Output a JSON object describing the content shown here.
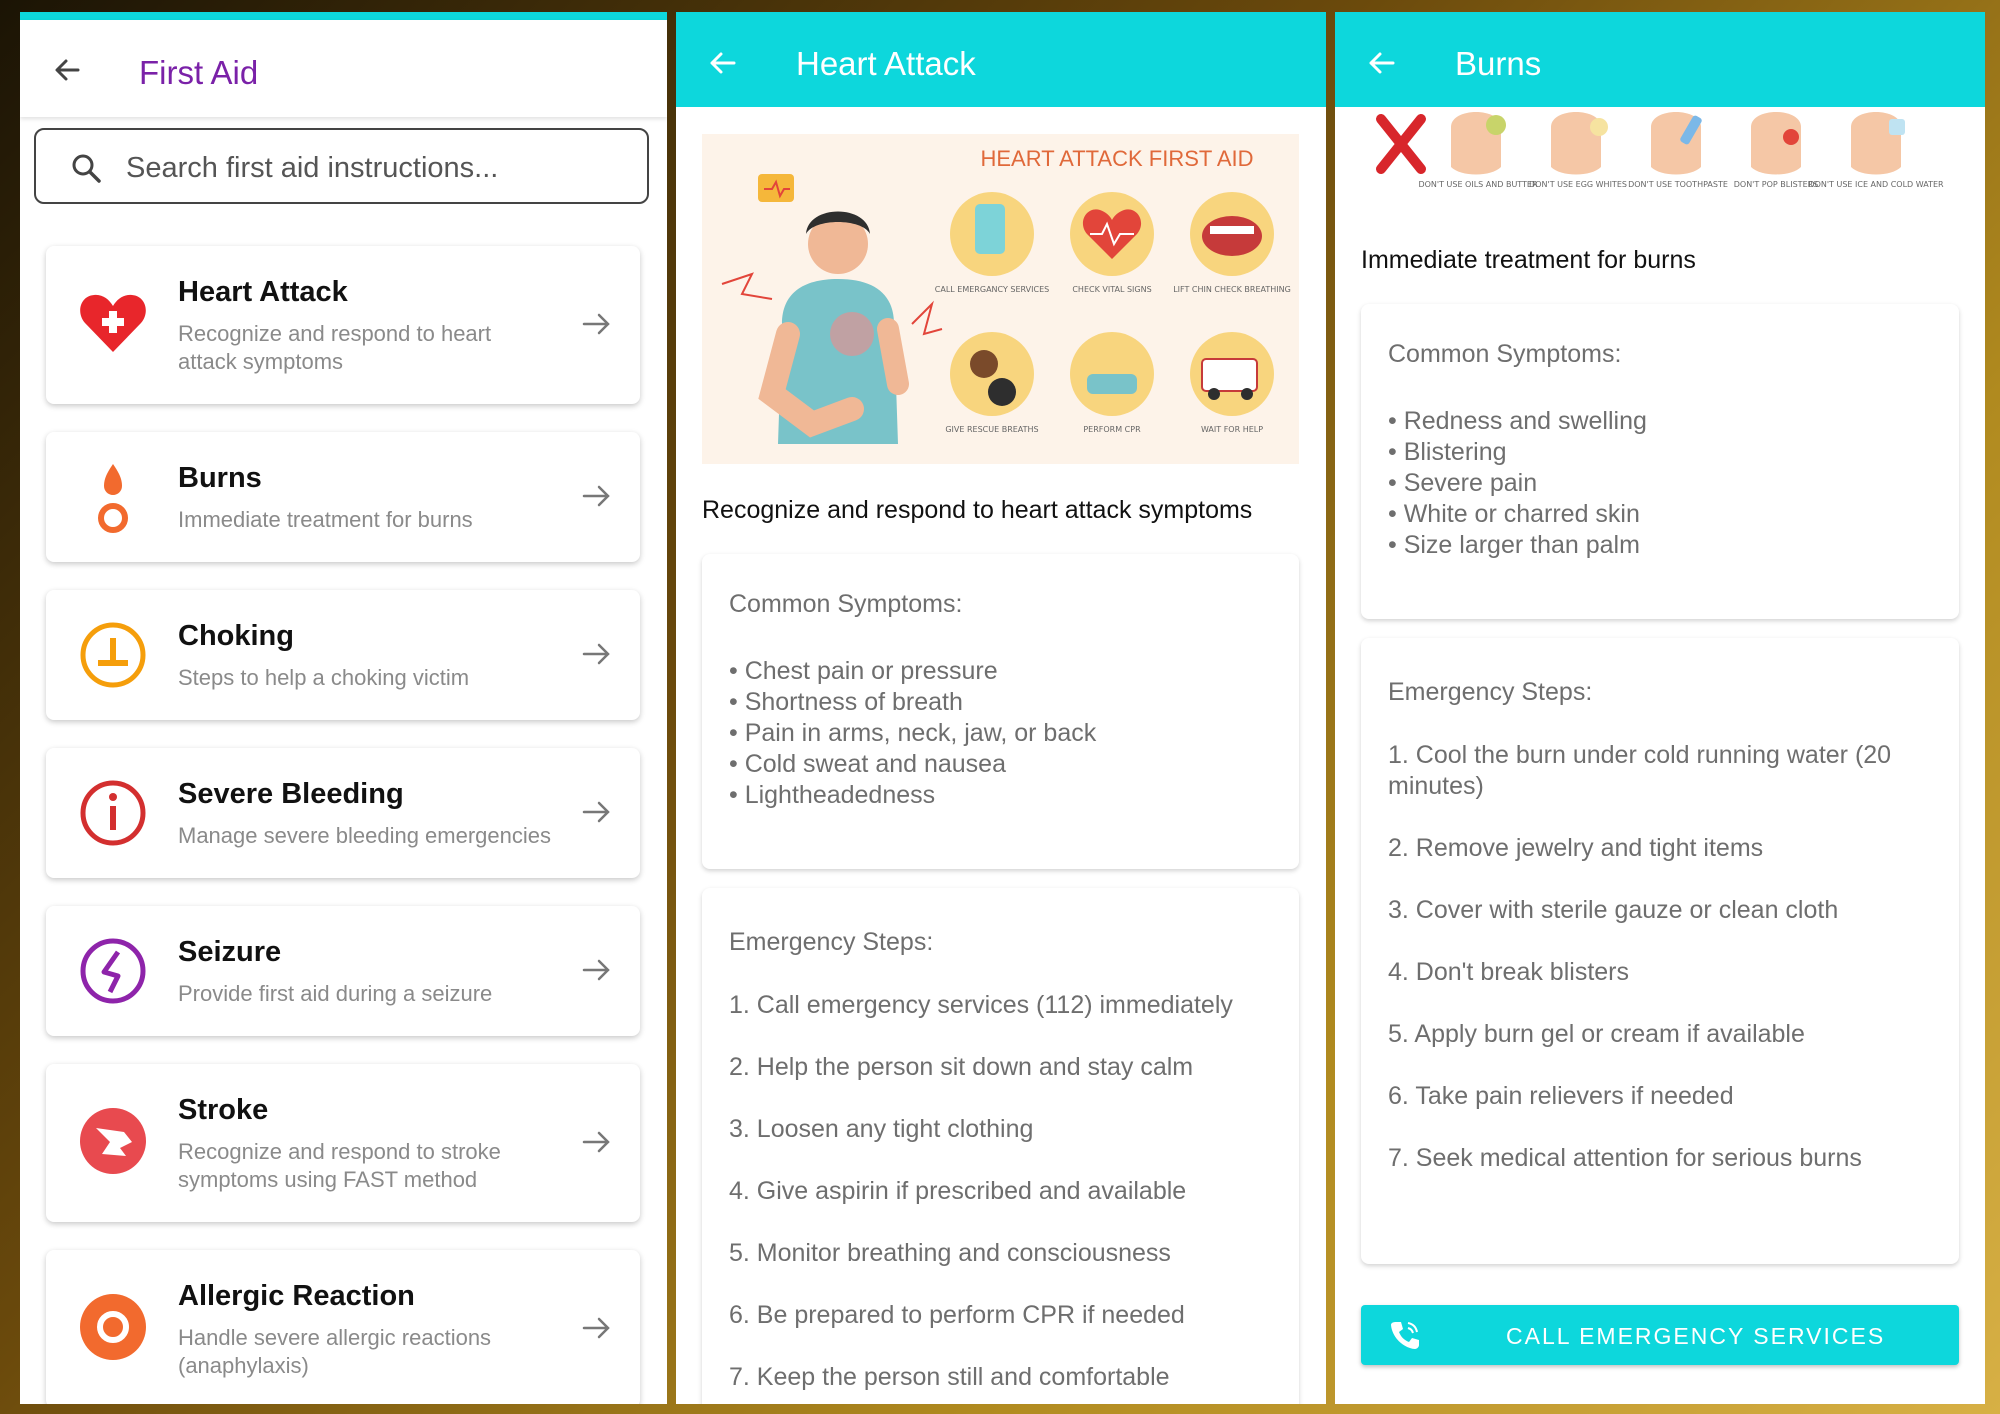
{
  "list_screen": {
    "title": "First Aid",
    "search_placeholder": "Search first aid instructions...",
    "items": [
      {
        "title": "Heart Attack",
        "subtitle": "Recognize and respond to heart attack symptoms",
        "icon": "heart-icon",
        "color": "#e8262b"
      },
      {
        "title": "Burns",
        "subtitle": "Immediate treatment for burns",
        "icon": "fire-icon",
        "color": "#f26a2e"
      },
      {
        "title": "Choking",
        "subtitle": "Steps to help a choking victim",
        "icon": "choking-icon",
        "color": "#f59e0b"
      },
      {
        "title": "Severe Bleeding",
        "subtitle": "Manage severe bleeding emergencies",
        "icon": "info-icon",
        "color": "#d32f2f"
      },
      {
        "title": "Seizure",
        "subtitle": "Provide first aid during a seizure",
        "icon": "seizure-icon",
        "color": "#8e24aa"
      },
      {
        "title": "Stroke",
        "subtitle": "Recognize and respond to stroke symptoms using FAST method",
        "icon": "stroke-icon",
        "color": "#e84a4f"
      },
      {
        "title": "Allergic Reaction",
        "subtitle": "Handle severe allergic reactions (anaphylaxis)",
        "icon": "allergy-icon",
        "color": "#f26a2e"
      }
    ]
  },
  "heart_screen": {
    "title": "Heart Attack",
    "image": {
      "heading": "HEART ATTACK FIRST AID",
      "labels": [
        "CALL EMERGANCY SERVICES",
        "CHECK VITAL SIGNS",
        "LIFT CHIN CHECK BREATHING",
        "GIVE RESCUE BREATHS",
        "PERFORM CPR",
        "WAIT FOR HELP"
      ]
    },
    "description": "Recognize and respond to heart attack symptoms",
    "symptoms_title": "Common Symptoms:",
    "symptoms": [
      "• Chest pain or pressure",
      "• Shortness of breath",
      "• Pain in arms, neck, jaw, or back",
      "• Cold sweat and nausea",
      "• Lightheadedness"
    ],
    "steps_title": "Emergency Steps:",
    "steps": [
      "1. Call emergency services (112) immediately",
      "2. Help the person sit down and stay calm",
      "3. Loosen any tight clothing",
      "4. Give aspirin if prescribed and available",
      "5. Monitor breathing and consciousness",
      "6. Be prepared to perform CPR if needed",
      "7. Keep the person still and comfortable"
    ]
  },
  "burns_screen": {
    "title": "Burns",
    "image": {
      "labels": [
        "DON'T USE OILS AND BUTTER",
        "DON'T USE EGG WHITES",
        "DON'T USE TOOTHPASTE",
        "DON'T POP BLISTERS",
        "DON'T USE ICE AND COLD WATER"
      ]
    },
    "description": "Immediate treatment for burns",
    "symptoms_title": "Common Symptoms:",
    "symptoms": [
      "• Redness and swelling",
      "• Blistering",
      "• Severe pain",
      "• White or charred skin",
      "• Size larger than palm"
    ],
    "steps_title": "Emergency Steps:",
    "steps": [
      "1. Cool the burn under cold running water (20 minutes)",
      "2. Remove jewelry and tight items",
      "3. Cover with sterile gauze or clean cloth",
      "4. Don't break blisters",
      "5. Apply burn gel or cream if available",
      "6. Take pain relievers if needed",
      "7. Seek medical attention for serious burns"
    ],
    "call_button": "CALL EMERGENCY SERVICES"
  },
  "colors": {
    "accent": "#0dd7dc",
    "title_purple": "#7a21a8"
  }
}
